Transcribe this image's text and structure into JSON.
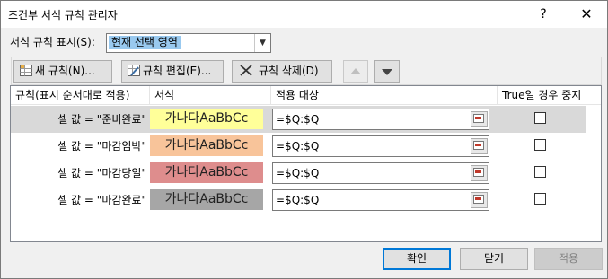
{
  "window": {
    "title": "조건부 서식 규칙 관리자",
    "help_glyph": "?",
    "close_glyph": "✕"
  },
  "show_rules": {
    "label": "서식 규칙 표시(S):",
    "selected": "현재 선택 영역"
  },
  "toolbar": {
    "new_rule": "새 규칙(N)...",
    "edit_rule": "규칙 편집(E)...",
    "delete_rule": "규칙 삭제(D)"
  },
  "table": {
    "headers": [
      "규칙(표시 순서대로 적용)",
      "서식",
      "적용 대상",
      "True일 경우 중지"
    ],
    "rows": [
      {
        "rule": "셀 값 = \"준비완료\"",
        "preview": "가나다AaBbCc",
        "fill": "#ffff99",
        "applies_to": "=$Q:$Q",
        "stop_if_true": false,
        "selected": true
      },
      {
        "rule": "셀 값 = \"마감임박\"",
        "preview": "가나다AaBbCc",
        "fill": "#f8c49a",
        "applies_to": "=$Q:$Q",
        "stop_if_true": false,
        "selected": false
      },
      {
        "rule": "셀 값 = \"마감당일\"",
        "preview": "가나다AaBbCc",
        "fill": "#de8d8d",
        "applies_to": "=$Q:$Q",
        "stop_if_true": false,
        "selected": false
      },
      {
        "rule": "셀 값 = \"마감완료\"",
        "preview": "가나다AaBbCc",
        "fill": "#a6a6a6",
        "applies_to": "=$Q:$Q",
        "stop_if_true": false,
        "selected": false
      }
    ]
  },
  "buttons": {
    "ok": "확인",
    "close": "닫기",
    "apply": "적용"
  }
}
